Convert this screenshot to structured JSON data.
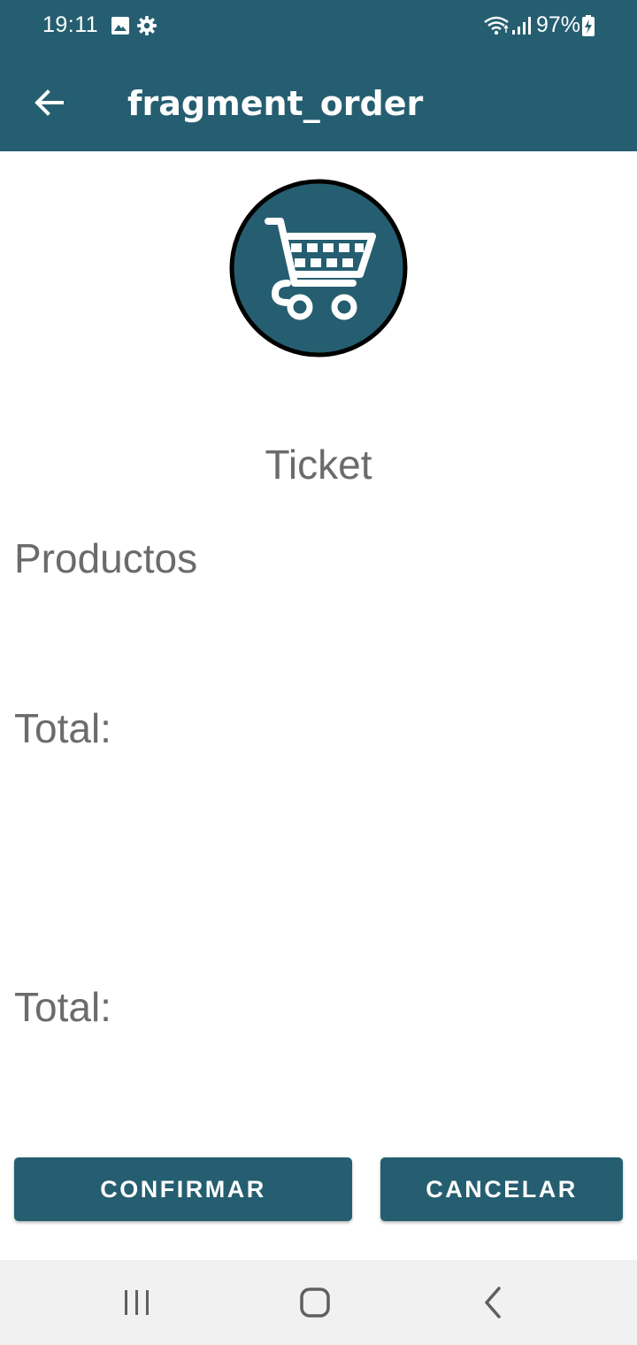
{
  "status_bar": {
    "time": "19:11",
    "battery": "97%",
    "icons": [
      "image-icon",
      "gear-icon",
      "wifi-icon",
      "signal-icon",
      "battery-charging-icon"
    ]
  },
  "app_bar": {
    "title": "fragment_order",
    "back_icon": "arrow-back-icon"
  },
  "header_image": {
    "icon": "shopping-cart-icon"
  },
  "content": {
    "ticket_label": "Ticket",
    "products_label": "Productos",
    "total_label_1": "Total:",
    "total_label_2": "Total:"
  },
  "actions": {
    "confirm_label": "CONFIRMAR",
    "cancel_label": "CANCELAR"
  },
  "nav_bar": {
    "icons": [
      "recent-apps-icon",
      "home-icon",
      "nav-back-icon"
    ]
  },
  "colors": {
    "primary": "#255e70",
    "text_secondary": "#6b6b6b",
    "nav_background": "#f1f1f1"
  }
}
